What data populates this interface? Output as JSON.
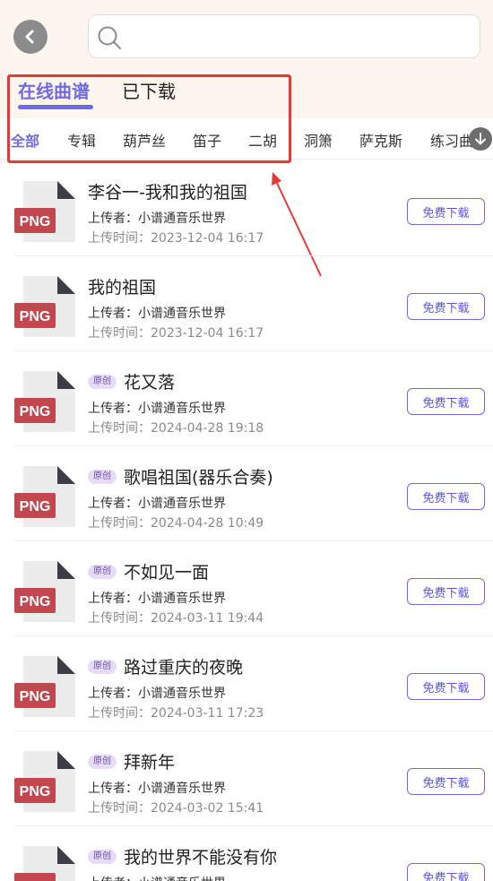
{
  "search": {
    "placeholder": ""
  },
  "tabs": {
    "online": "在线曲谱",
    "downloaded": "已下载"
  },
  "categories": [
    "全部",
    "专辑",
    "葫芦丝",
    "笛子",
    "二胡",
    "洞箫",
    "萨克斯",
    "练习曲"
  ],
  "active_category": "全部",
  "colors": {
    "accent": "#6f6be3",
    "header_bg": "#fdf6ee",
    "annotation": "#e53a3a",
    "png_badge": "#c2474f"
  },
  "file_icon_label": "PNG",
  "items": [
    {
      "title": "李谷一-我和我的祖国",
      "badge": "",
      "uploader": "上传者：小谱通音乐世界",
      "time": "上传时间：2023-12-04 16:17",
      "button": "免费下载"
    },
    {
      "title": "我的祖国",
      "badge": "",
      "uploader": "上传者：小谱通音乐世界",
      "time": "上传时间：2023-12-04 16:17",
      "button": "免费下载"
    },
    {
      "title": "花又落",
      "badge": "原创",
      "uploader": "上传者：小谱通音乐世界",
      "time": "上传时间：2024-04-28 19:18",
      "button": "免费下载"
    },
    {
      "title": "歌唱祖国(器乐合奏)",
      "badge": "原创",
      "uploader": "上传者：小谱通音乐世界",
      "time": "上传时间：2024-04-28 10:49",
      "button": "免费下载"
    },
    {
      "title": "不如见一面",
      "badge": "原创",
      "uploader": "上传者：小谱通音乐世界",
      "time": "上传时间：2024-03-11 19:44",
      "button": "免费下载"
    },
    {
      "title": "路过重庆的夜晚",
      "badge": "原创",
      "uploader": "上传者：小谱通音乐世界",
      "time": "上传时间：2024-03-11 17:23",
      "button": "免费下载"
    },
    {
      "title": "拜新年",
      "badge": "原创",
      "uploader": "上传者：小谱通音乐世界",
      "time": "上传时间：2024-03-02 15:41",
      "button": "免费下载"
    },
    {
      "title": "我的世界不能没有你",
      "badge": "原创",
      "uploader": "上传者：小谱通音乐世界",
      "time": "",
      "button": "免费下载"
    }
  ]
}
